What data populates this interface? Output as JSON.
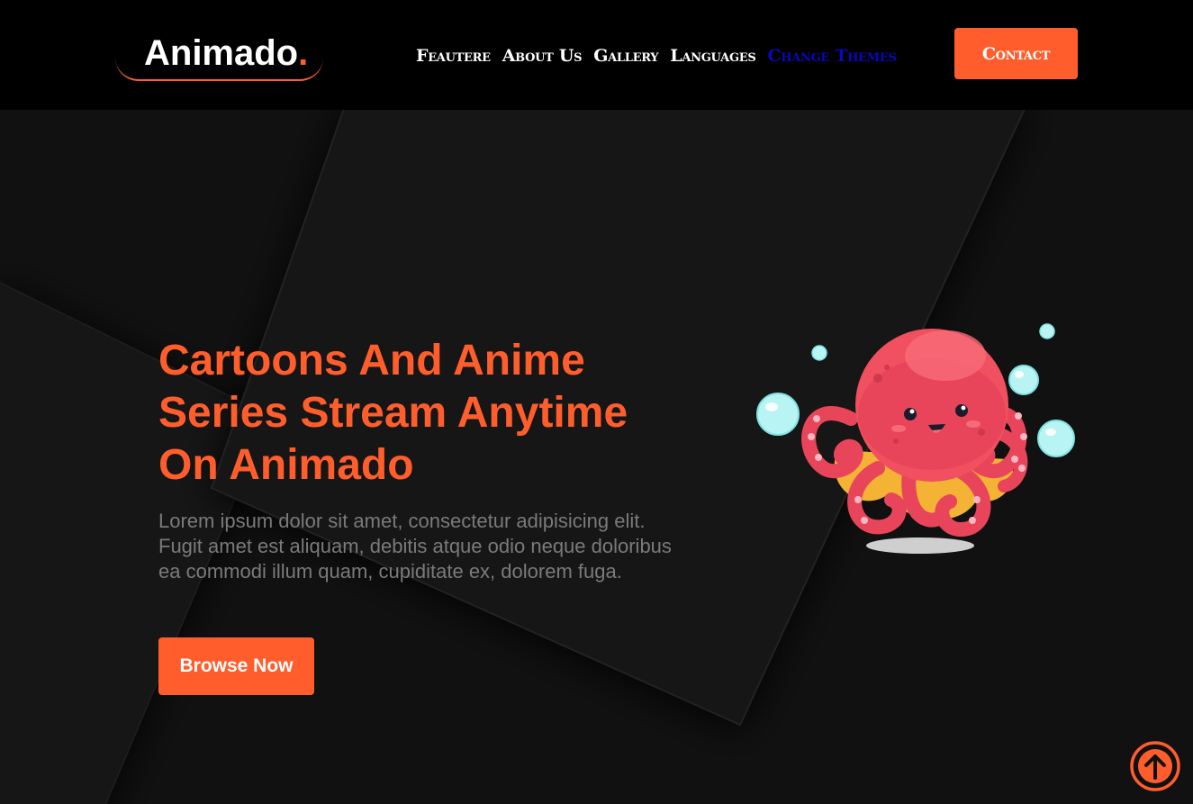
{
  "header": {
    "logo_text": "Animado",
    "logo_dot": ".",
    "nav": {
      "feature": "Feautere",
      "about": "About Us",
      "gallery": "Gallery",
      "languages": "Languages",
      "themes": "Change Themes"
    },
    "contact_label": "Contact"
  },
  "hero": {
    "title": "Cartoons And Anime Series Stream Anytime On Animado",
    "description": "Lorem ipsum dolor sit amet, consectetur adipisicing elit. Fugit amet est aliquam, debitis atque odio neque doloribus ea commodi illum quam, cupiditate ex, dolorem fuga.",
    "button_label": "Browse Now",
    "illustration": "octopus-illustration"
  },
  "scroll_top_icon": "arrow-up-circle-icon",
  "colors": {
    "accent": "#ff5e2c",
    "background": "#111111",
    "header_bg": "#000000",
    "text_muted": "#7a7a7a",
    "theme_link": "#0a08b8"
  }
}
